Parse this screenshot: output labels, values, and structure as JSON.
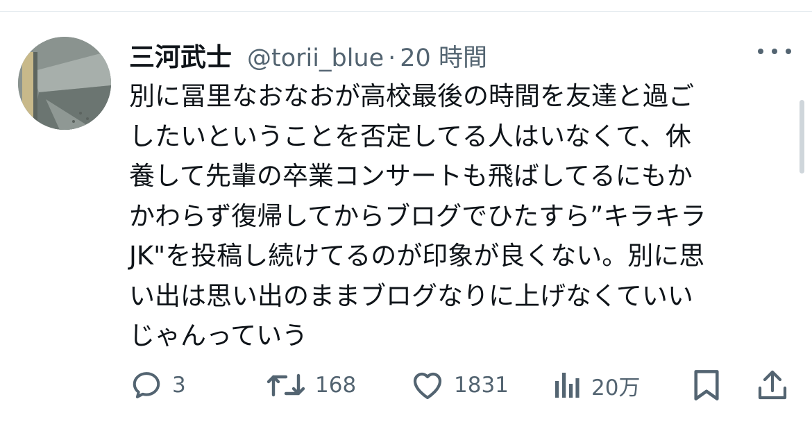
{
  "tweet": {
    "author": {
      "display_name": "三河武士",
      "handle": "@torii_blue"
    },
    "separator": "·",
    "time": "20 時間",
    "body_lines": [
      "別に冨里なおなおが高校最後の時間を友達と過ご",
      "したいということを否定してる人はいなくて、休",
      "養して先輩の卒業コンサートも飛ばしてるにもか",
      "かわらず復帰してからブログでひたすら”キラキラ",
      "JK\"を投稿し続けてるのが印象が良くない。別に思",
      "い出は思い出のままブログなりに上げなくていい",
      "じゃんっていう"
    ],
    "actions": {
      "reply_count": "3",
      "retweet_count": "168",
      "like_count": "1831",
      "view_count": "20万"
    }
  },
  "icons": {
    "more": "more-horizontal-icon",
    "reply": "reply-icon",
    "retweet": "retweet-icon",
    "like": "heart-icon",
    "views": "views-icon",
    "bookmark": "bookmark-icon",
    "share": "share-icon"
  },
  "colors": {
    "text_primary": "#0f1419",
    "text_secondary": "#536471",
    "divider": "#e6ecf0"
  }
}
